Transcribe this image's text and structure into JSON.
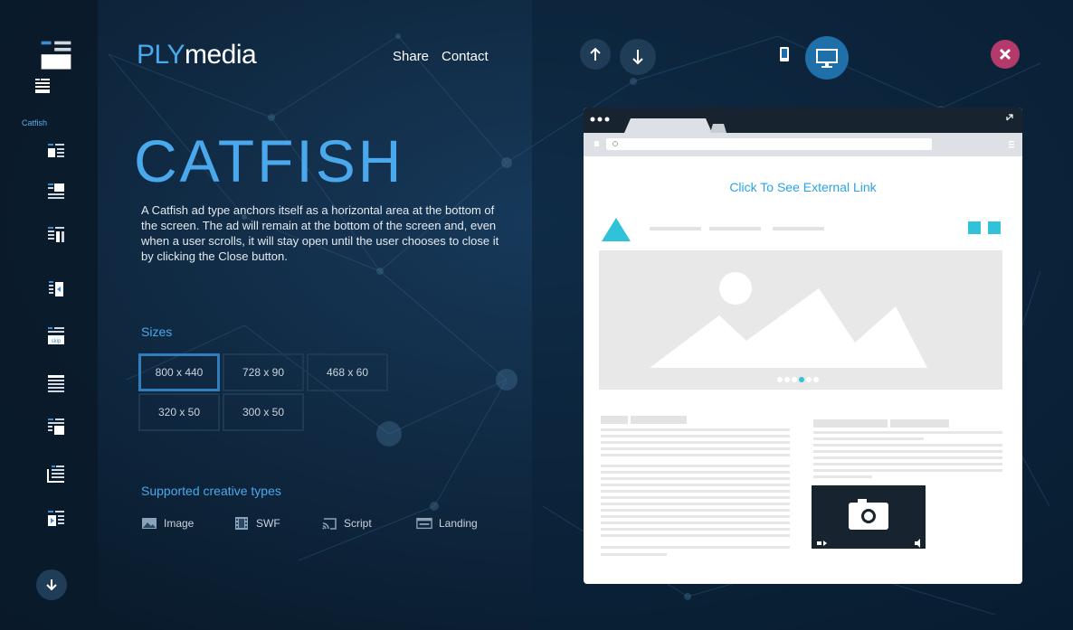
{
  "logo": {
    "ply": "PLY",
    "media": "media"
  },
  "nav": {
    "share": "Share",
    "contact": "Contact"
  },
  "sidebar": {
    "active_label": "Catfish",
    "items": [
      "standard-banner",
      "catfish",
      "video-banner",
      "expanding-banner",
      "inline-banner",
      "side-slider",
      "skippable",
      "full-page",
      "interstitial",
      "scroll-reveal",
      "video-inline"
    ],
    "skip_text": "skip"
  },
  "main": {
    "title": "CATFISH",
    "description": "A Catfish ad type anchors itself as a horizontal area at the bottom of the screen. The ad will remain at the bottom of the screen and, even when a user scrolls, it will stay open until the user chooses to close it by clicking the Close button.",
    "sizes_heading": "Sizes",
    "sizes": [
      "800 x 440",
      "728 x 90",
      "468 x 60",
      "320 x 50",
      "300 x 50"
    ],
    "selected_size": "800 x 440",
    "creative_heading": "Supported creative types",
    "creative_types": [
      "Image",
      "SWF",
      "Script",
      "Landing"
    ]
  },
  "preview": {
    "link_text": "Click To See External Link",
    "device": "desktop",
    "carousel_active_dot": 3
  },
  "colors": {
    "accent": "#4aa8ec",
    "close": "#b33a6a",
    "link": "#2ba3e8",
    "teal": "#2fc2d8"
  }
}
